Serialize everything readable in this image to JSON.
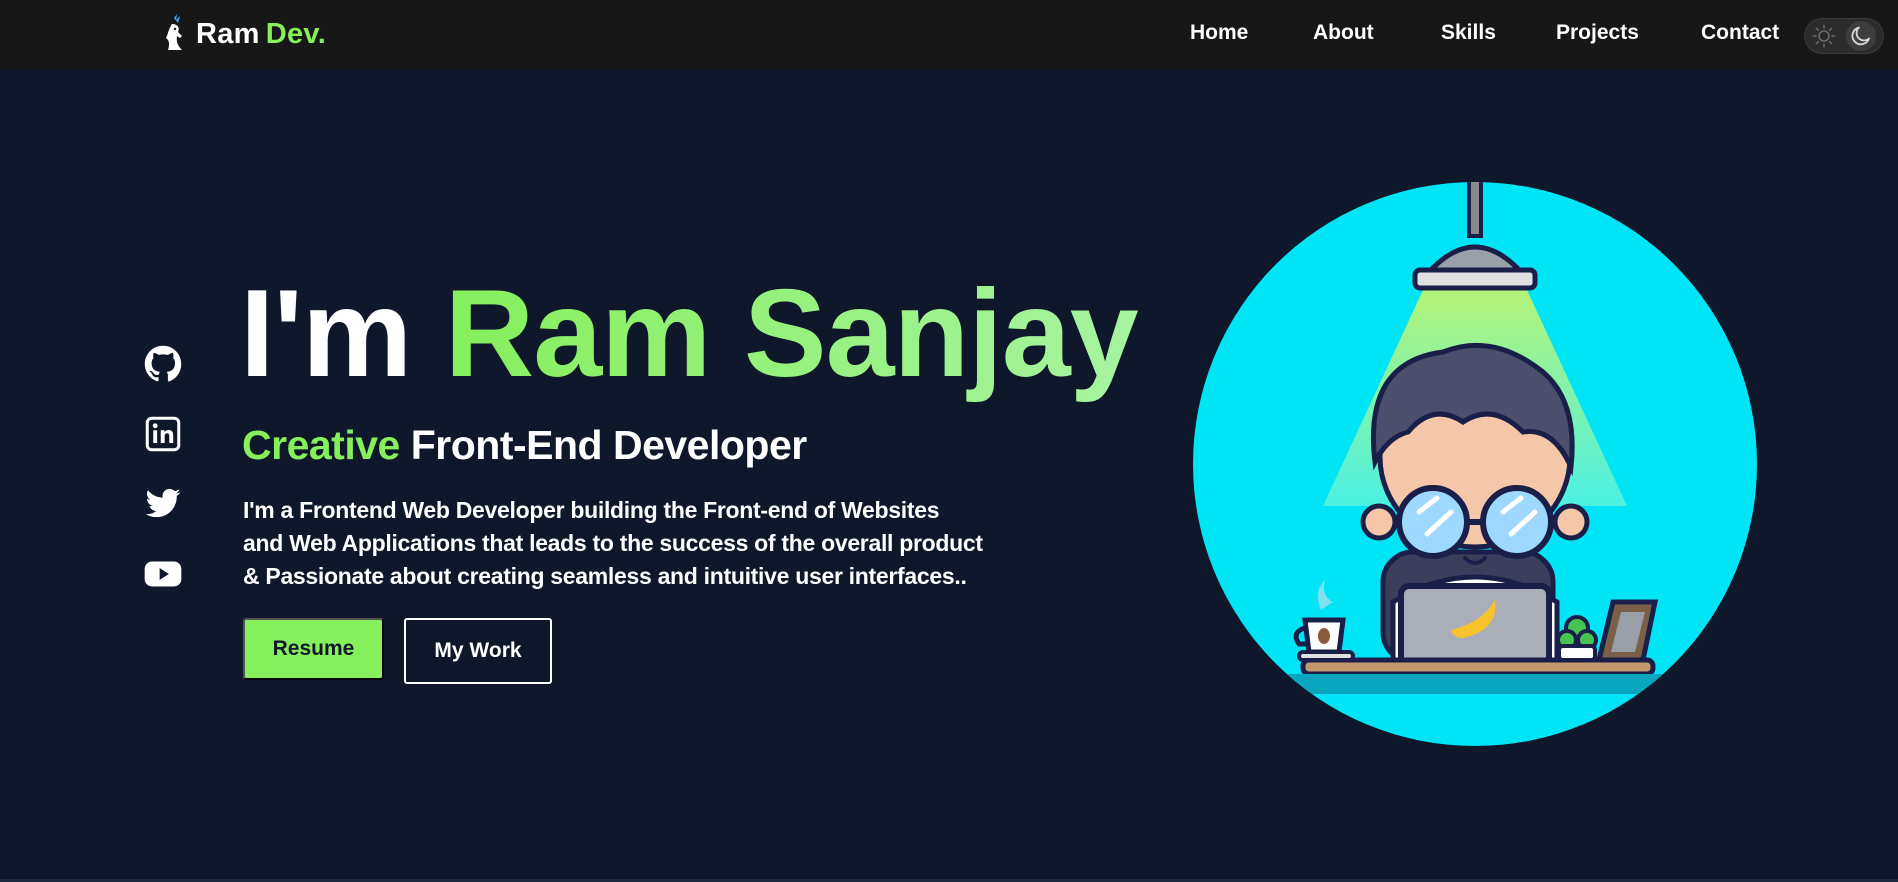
{
  "brand": {
    "name": "Ram",
    "accent": "Dev.",
    "logo_icon": "deer-logo-icon"
  },
  "nav": {
    "items": [
      {
        "label": "Home"
      },
      {
        "label": "About"
      },
      {
        "label": "Skills"
      },
      {
        "label": "Projects"
      },
      {
        "label": "Contact"
      }
    ],
    "theme_toggle": {
      "light_icon": "sun-icon",
      "dark_icon": "moon-icon",
      "state": "dark"
    }
  },
  "socials": [
    {
      "name": "github",
      "icon": "github-icon"
    },
    {
      "name": "linkedin",
      "icon": "linkedin-icon"
    },
    {
      "name": "twitter",
      "icon": "twitter-icon"
    },
    {
      "name": "youtube",
      "icon": "youtube-icon"
    }
  ],
  "hero": {
    "title_prefix": "I'm",
    "title_name": "Ram Sanjay",
    "subtitle_accent": "Creative",
    "subtitle_rest": "Front-End Developer",
    "description_lines": [
      "I'm a Frontend Web Developer building the Front-end of Websites",
      "and Web Applications that leads to the success of the overall product",
      "& Passionate about creating seamless and intuitive user interfaces.."
    ],
    "buttons": {
      "resume": "Resume",
      "work": "My Work"
    },
    "illustration": "developer-at-laptop-illustration"
  },
  "colors": {
    "background": "#0f172a",
    "navbar": "#171717",
    "accent": "#86ef5c",
    "illustration_bg": "#00e5f5"
  }
}
